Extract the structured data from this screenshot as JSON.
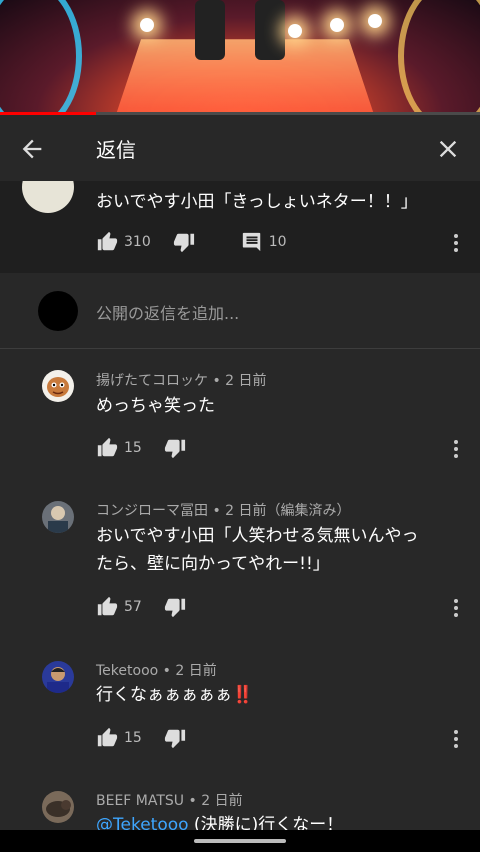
{
  "header": {
    "title": "返信"
  },
  "video": {
    "progress_fraction": 0.2
  },
  "parent_comment": {
    "text": "おいでやす小田「きっしょいネター！！」",
    "likes": "310",
    "replies": "10"
  },
  "add_reply": {
    "placeholder": "公開の返信を追加..."
  },
  "replies": [
    {
      "author": "揚げたてコロッケ • 2 日前",
      "text": "めっちゃ笑った",
      "likes": "15"
    },
    {
      "author": "コンジローマ冨田 • 2 日前（編集済み）",
      "text_line1": "おいでやす小田「人笑わせる気無いんやっ",
      "text_line2": "たら、壁に向かってやれー!!」",
      "likes": "57"
    },
    {
      "author": "Teketooo • 2 日前",
      "text": "行くなぁぁぁぁぁ",
      "emoji": "‼️",
      "likes": "15"
    },
    {
      "author": "BEEF MATSU • 2 日前",
      "mention": "@Teketooo",
      "text": " (決勝に)行くなー！"
    }
  ],
  "icons": {
    "back": "arrow-left-icon",
    "close": "close-icon",
    "like": "thumbs-up-icon",
    "dislike": "thumbs-down-icon",
    "comment": "comment-icon",
    "more": "more-vert-icon"
  },
  "colors": {
    "accent_link": "#3ea6ff",
    "progress": "#ff0000"
  }
}
